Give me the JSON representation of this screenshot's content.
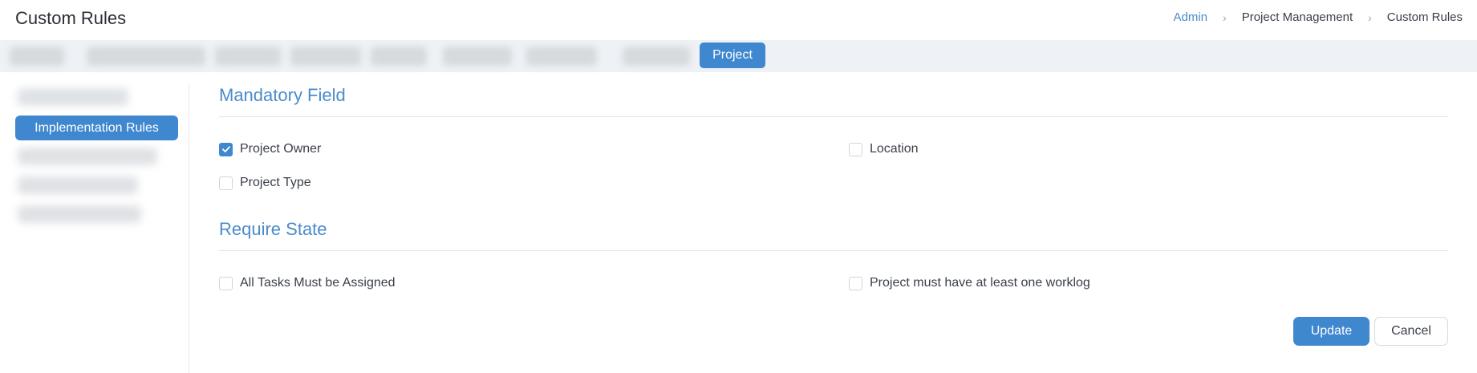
{
  "header": {
    "title": "Custom Rules",
    "breadcrumb": [
      "Admin",
      "Project Management",
      "Custom Rules"
    ]
  },
  "tabs": {
    "active_label": "Project"
  },
  "sidebar": {
    "active_label": "Implementation Rules"
  },
  "sections": {
    "mandatory": {
      "title": "Mandatory Field",
      "fields": [
        {
          "label": "Project Owner",
          "checked": true
        },
        {
          "label": "Location",
          "checked": false
        },
        {
          "label": "Project Type",
          "checked": false
        }
      ]
    },
    "require_state": {
      "title": "Require State",
      "fields": [
        {
          "label": "All Tasks Must be Assigned",
          "checked": false
        },
        {
          "label": "Project must have at least one worklog",
          "checked": false
        }
      ]
    }
  },
  "actions": {
    "update_label": "Update",
    "cancel_label": "Cancel"
  },
  "colors": {
    "accent": "#3f87cf",
    "link": "#4a8bcc"
  },
  "icons": {
    "checkmark": "check-icon",
    "breadcrumb_separator": "chevron-right-icon"
  }
}
